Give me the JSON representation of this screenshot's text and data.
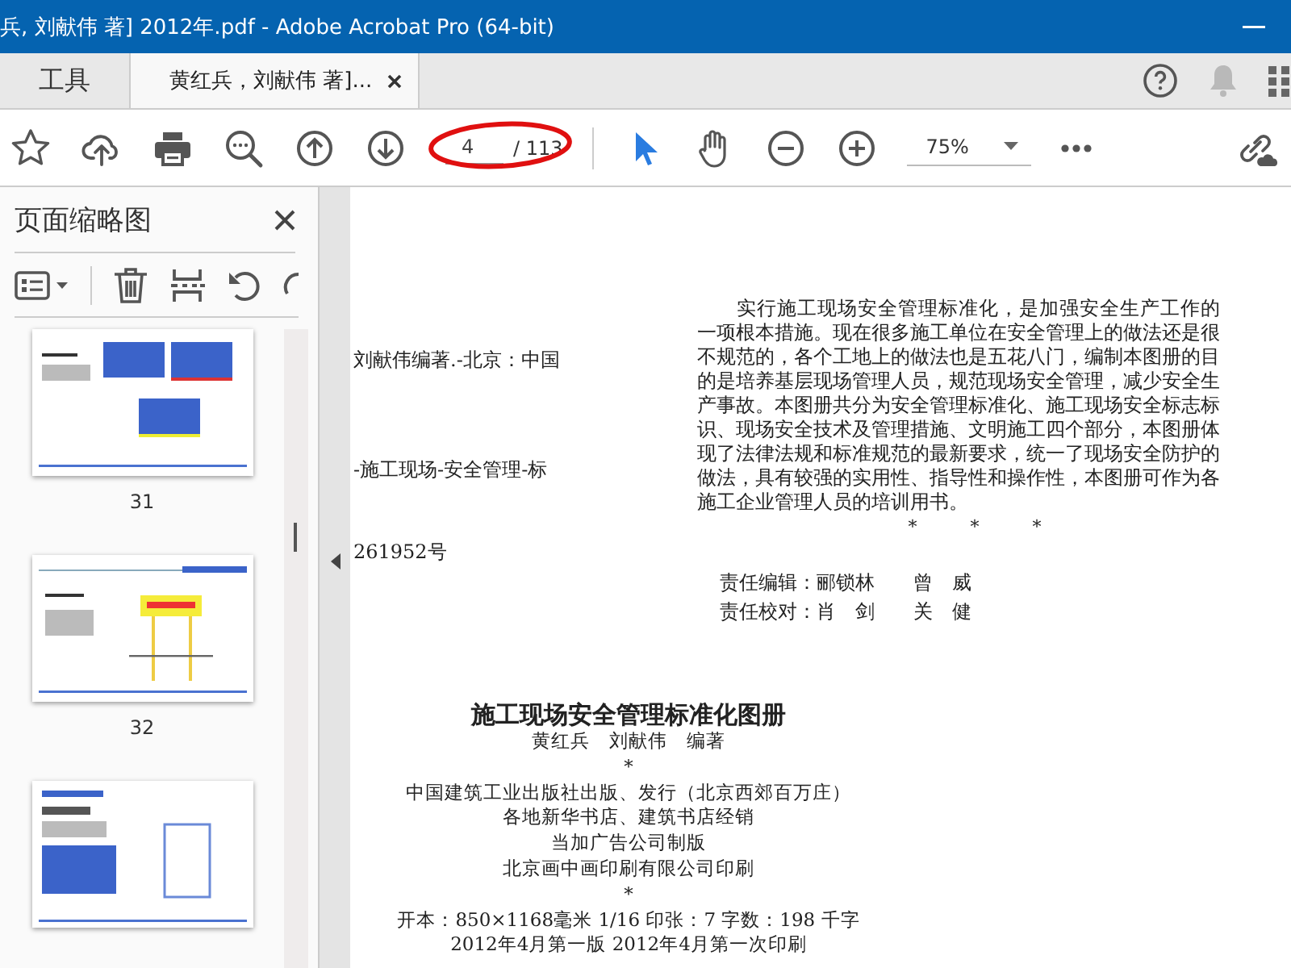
{
  "window": {
    "title": "兵, 刘献伟 著] 2012年.pdf - Adobe Acrobat Pro (64-bit)"
  },
  "tabs": [
    {
      "label": "工具",
      "selected": false,
      "closable": false
    },
    {
      "label": "黄红兵，刘献伟 著]...",
      "selected": true,
      "closable": true
    }
  ],
  "toolbar": {
    "page_number": "4",
    "page_count": "/ 113",
    "zoom": "75%",
    "tools": [
      {
        "kind": "select",
        "selected": true
      },
      {
        "kind": "hand",
        "selected": false
      }
    ]
  },
  "sidebar": {
    "title": "页面缩略图",
    "thumbnails": [
      {
        "kind": "signs",
        "label": "31"
      },
      {
        "kind": "post-sign",
        "label": "32"
      },
      {
        "kind": "table"
      }
    ]
  },
  "document": {
    "left_lines": [
      "刘献伟编著.-北京：中国",
      "-施工现场-安全管理-标",
      "261952号"
    ],
    "paragraph": "实行施工现场安全管理标准化，是加强安全生产工作的一项根本措施。现在很多施工单位在安全管理上的做法还是很不规范的，各个工地上的做法也是五花八门，编制本图册的目的是培养基层现场管理人员，规范现场安全管理，减少安全生产事故。本图册共分为安全管理标准化、施工现场安全标志标识、现场安全技术及管理措施、文明施工四个部分，本图册体现了法律法规和标准规范的最新要求，统一了现场安全防护的做法，具有较强的实用性、指导性和操作性，本图册可作为各施工企业管理人员的培训用书。",
    "separator": "*　　　*　　　*",
    "credits": [
      "责任编辑：郦锁林　　曾　威",
      "责任校对：肖　剑　　关　健"
    ],
    "colophon": {
      "title": "施工现场安全管理标准化图册",
      "lines": [
        "黄红兵　刘献伟　编著",
        "*",
        "中国建筑工业出版社出版、发行（北京西郊百万庄）",
        "各地新华书店、建筑书店经销",
        "当加广告公司制版",
        "北京画中画印刷有限公司印刷",
        "*",
        "开本：850×1168毫米 1/16 印张：7 字数：198 千字",
        "2012年4月第一版 2012年4月第一次印刷"
      ]
    }
  }
}
